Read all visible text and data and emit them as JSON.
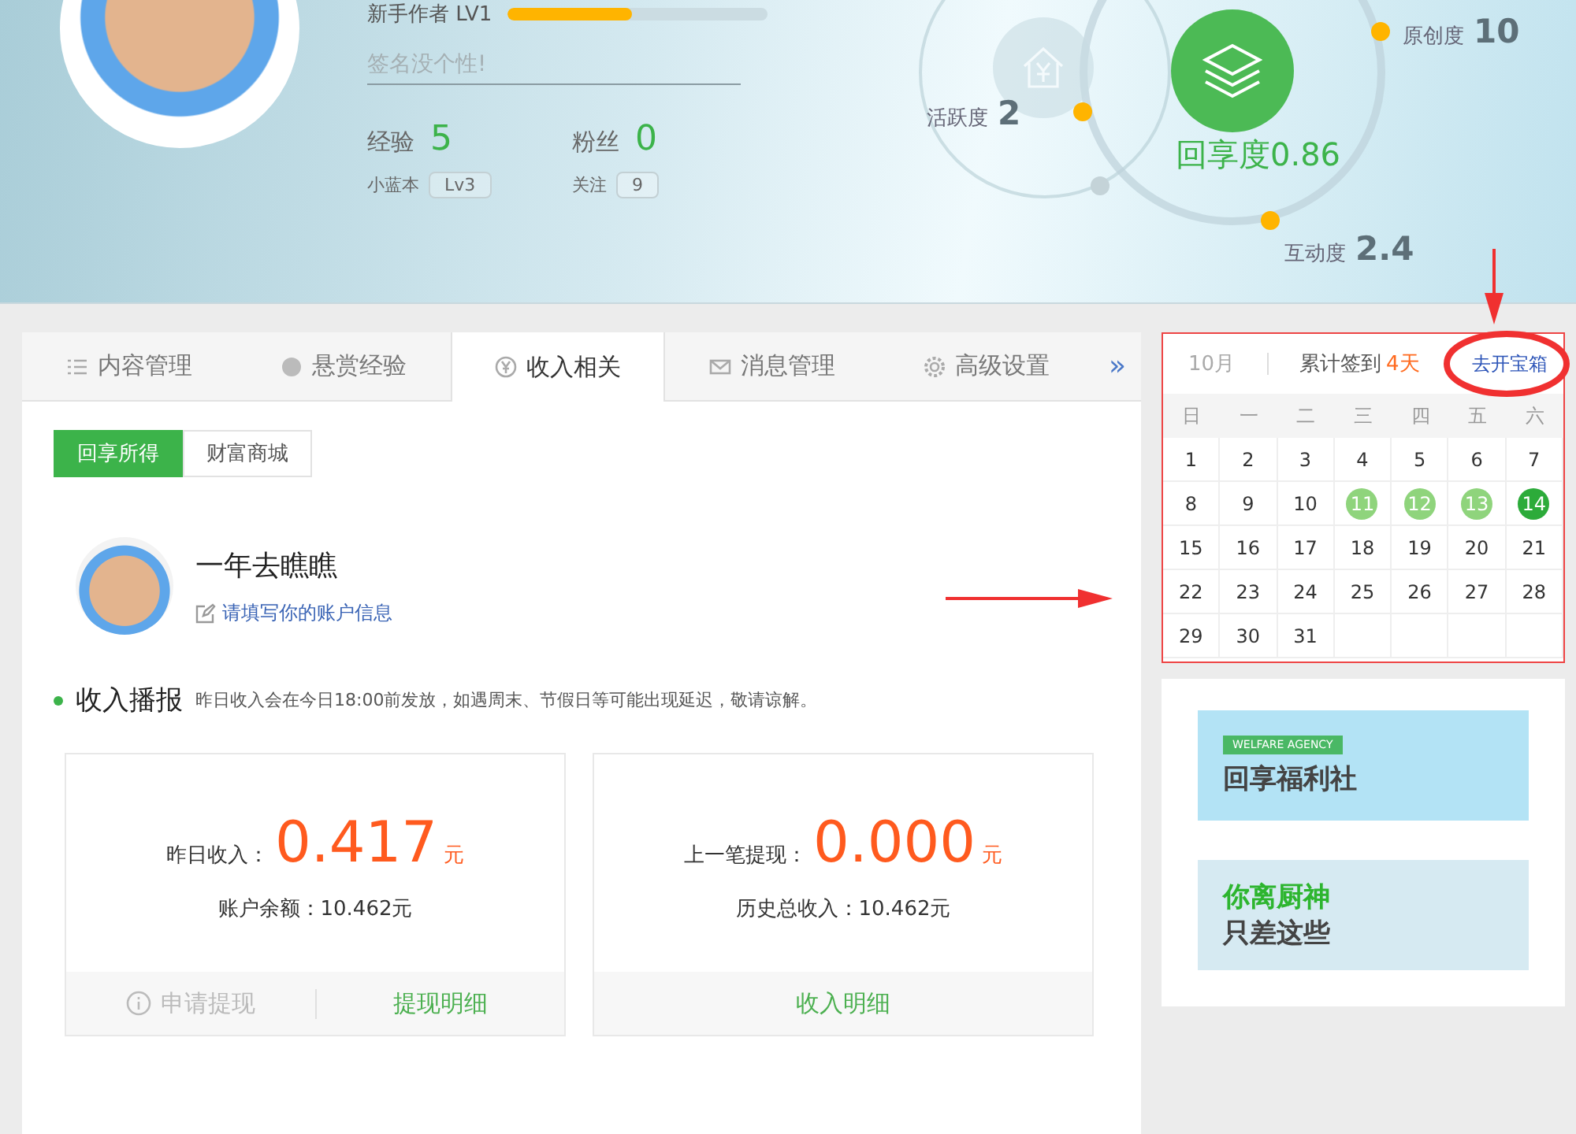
{
  "profile": {
    "rank": "新手作者 LV1",
    "rank_progress": {
      "level": 0.48
    },
    "signature": {
      "placeholder": "签名没个性!"
    },
    "stats": [
      {
        "label": "经验",
        "value": "5"
      },
      {
        "label": "粉丝",
        "value": "0"
      }
    ],
    "sub_stats": [
      {
        "label": "小蓝本",
        "value": "Lv3"
      },
      {
        "label": "关注",
        "value": "9"
      }
    ]
  },
  "scores": {
    "main": {
      "label": "回享度",
      "value": "0.86"
    },
    "items": [
      {
        "kind": "activity",
        "label": "活跃度",
        "value": "2"
      },
      {
        "kind": "originality",
        "label": "原创度",
        "value": "10"
      },
      {
        "kind": "interaction",
        "label": "互动度",
        "value": "2.4"
      }
    ]
  },
  "tabs": [
    {
      "kind": "list",
      "label": "内容管理",
      "selected": false
    },
    {
      "kind": "reward",
      "label": "悬赏经验",
      "selected": false
    },
    {
      "kind": "yen",
      "label": "收入相关",
      "selected": true
    },
    {
      "kind": "mail",
      "label": "消息管理",
      "selected": false
    },
    {
      "kind": "gear",
      "label": "高级设置",
      "selected": false
    }
  ],
  "tabs_more": "»",
  "sub_tabs": [
    {
      "label": "回享所得",
      "selected": true
    },
    {
      "label": "财富商城",
      "selected": false
    }
  ],
  "account": {
    "name": "一年去瞧瞧",
    "link": "请填写你的账户信息"
  },
  "income_section": {
    "title": "收入播报",
    "note": "昨日收入会在今日18:00前发放，如遇周末、节假日等可能出现延迟，敬请谅解。"
  },
  "income_cards": [
    {
      "label": "昨日收入：",
      "amount": "0.417",
      "unit": "元",
      "detail": "账户余额：10.462元",
      "actions": [
        {
          "label": "申请提现",
          "disabled": true
        },
        {
          "label": "提现明细",
          "disabled": false
        }
      ]
    },
    {
      "label": "上一笔提现：",
      "amount": "0.000",
      "unit": "元",
      "detail": "历史总收入：10.462元",
      "actions": [
        {
          "label": "收入明细",
          "disabled": false
        }
      ]
    }
  ],
  "calendar": {
    "month": "10月",
    "summary": "累计签到",
    "count": "4天",
    "chest_link": "去开宝箱",
    "weekdays": [
      "日",
      "一",
      "二",
      "三",
      "四",
      "五",
      "六"
    ],
    "days": [
      {
        "label": "1",
        "kind": "plain"
      },
      {
        "label": "2",
        "kind": "plain"
      },
      {
        "label": "3",
        "kind": "plain"
      },
      {
        "label": "4",
        "kind": "plain"
      },
      {
        "label": "5",
        "kind": "plain"
      },
      {
        "label": "6",
        "kind": "plain"
      },
      {
        "label": "7",
        "kind": "plain"
      },
      {
        "label": "8",
        "kind": "plain"
      },
      {
        "label": "9",
        "kind": "plain"
      },
      {
        "label": "10",
        "kind": "plain"
      },
      {
        "label": "11",
        "kind": "signed"
      },
      {
        "label": "12",
        "kind": "signed"
      },
      {
        "label": "13",
        "kind": "signed"
      },
      {
        "label": "14",
        "kind": "today"
      },
      {
        "label": "15",
        "kind": "plain"
      },
      {
        "label": "16",
        "kind": "plain"
      },
      {
        "label": "17",
        "kind": "plain"
      },
      {
        "label": "18",
        "kind": "plain"
      },
      {
        "label": "19",
        "kind": "plain"
      },
      {
        "label": "20",
        "kind": "plain"
      },
      {
        "label": "21",
        "kind": "plain"
      },
      {
        "label": "22",
        "kind": "plain"
      },
      {
        "label": "23",
        "kind": "plain"
      },
      {
        "label": "24",
        "kind": "plain"
      },
      {
        "label": "25",
        "kind": "plain"
      },
      {
        "label": "26",
        "kind": "plain"
      },
      {
        "label": "27",
        "kind": "plain"
      },
      {
        "label": "28",
        "kind": "plain"
      },
      {
        "label": "29",
        "kind": "plain"
      },
      {
        "label": "30",
        "kind": "plain"
      },
      {
        "label": "31",
        "kind": "plain"
      }
    ]
  },
  "banners": [
    {
      "kind": "welfare",
      "tag": "WELFARE AGENCY",
      "title": "回享福利社"
    },
    {
      "kind": "kitchen",
      "title": "你离厨神",
      "subtitle": "只差这些"
    }
  ]
}
